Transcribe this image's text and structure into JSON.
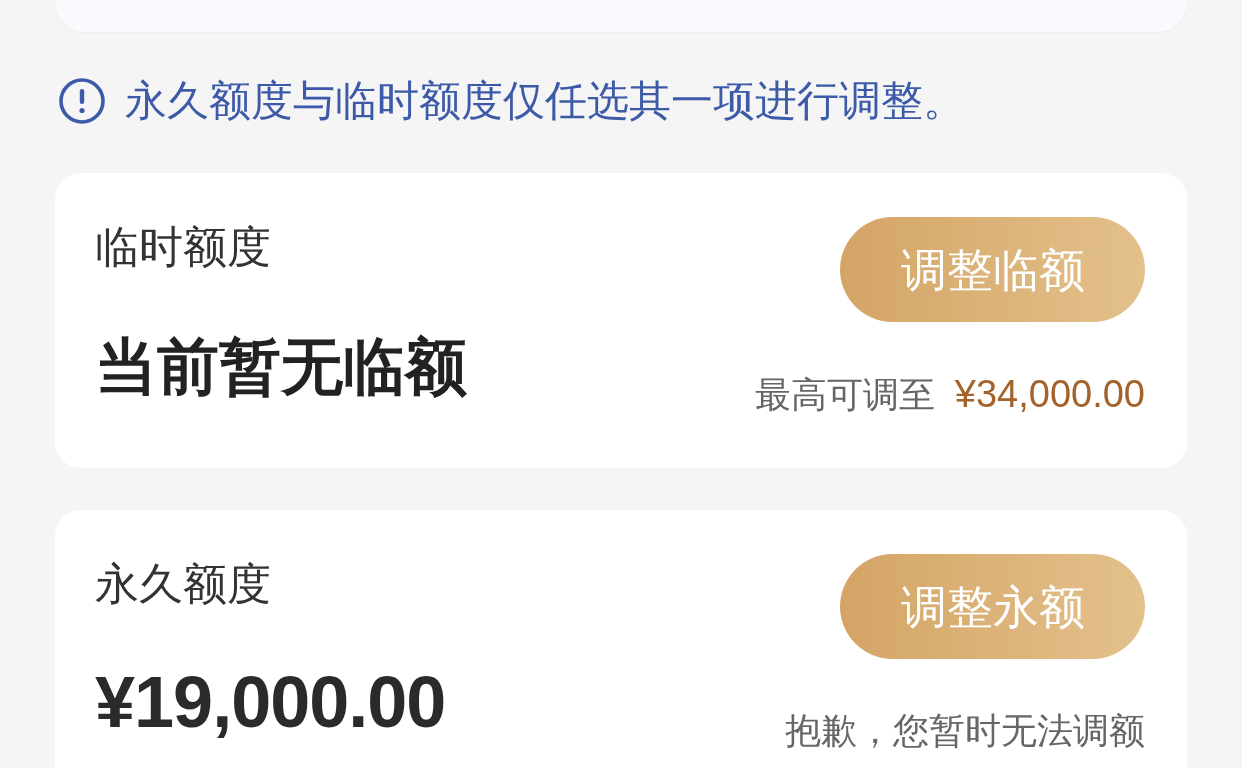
{
  "notice": {
    "text": "永久额度与临时额度仅任选其一项进行调整。"
  },
  "quota_cards": [
    {
      "title": "临时额度",
      "value": {
        "kind": "message",
        "text": "当前暂无临额"
      },
      "button": "调整临额",
      "note": {
        "text": "最高可调至",
        "amount": "¥34,000.00"
      }
    },
    {
      "title": "永久额度",
      "value": {
        "kind": "amount",
        "text": "¥19,000.00"
      },
      "button": "调整永额",
      "note": {
        "text": "抱歉，您暂时无法调额"
      }
    }
  ]
}
